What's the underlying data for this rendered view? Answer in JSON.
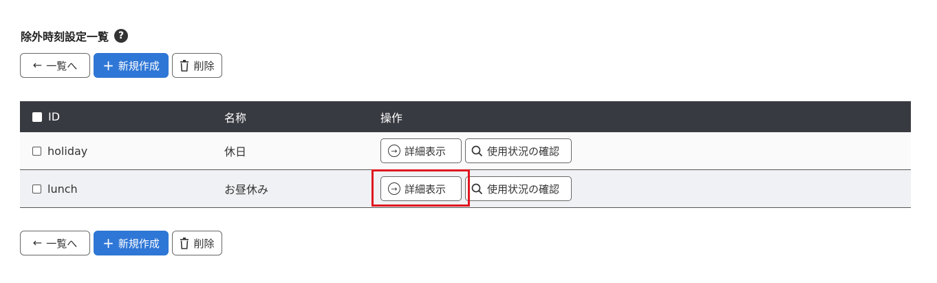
{
  "page": {
    "title": "除外時刻設定一覧",
    "help_icon": "?"
  },
  "toolbar": {
    "back_label": "一覧へ",
    "back_icon": "←",
    "new_label": "新規作成",
    "new_icon": "+",
    "delete_label": "削除",
    "delete_icon": "trash-icon"
  },
  "table": {
    "columns": [
      "ID",
      "名称",
      "操作"
    ],
    "rows": [
      {
        "id": "holiday",
        "name": "休日",
        "detail_label": "詳細表示",
        "usage_label": "使用状況の確認"
      },
      {
        "id": "lunch",
        "name": "お昼休み",
        "detail_label": "詳細表示",
        "usage_label": "使用状況の確認"
      }
    ]
  },
  "colors": {
    "primary": "#2f77d6",
    "header_bg": "#383a41",
    "highlight": "#e0141e"
  }
}
